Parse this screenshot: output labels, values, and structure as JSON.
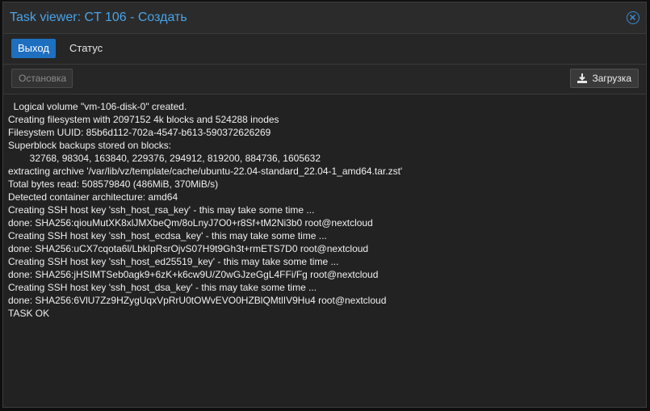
{
  "window": {
    "title": "Task viewer: CT 106 - Создать"
  },
  "tabs": [
    {
      "label": "Выход",
      "active": true
    },
    {
      "label": "Статус",
      "active": false
    }
  ],
  "toolbar": {
    "stop_label": "Остановка",
    "download_label": "Загрузка",
    "download_icon": "download-icon"
  },
  "log": {
    "lines": [
      "  Logical volume \"vm-106-disk-0\" created.",
      "Creating filesystem with 2097152 4k blocks and 524288 inodes",
      "Filesystem UUID: 85b6d112-702a-4547-b613-590372626269",
      "Superblock backups stored on blocks:",
      "        32768, 98304, 163840, 229376, 294912, 819200, 884736, 1605632",
      "extracting archive '/var/lib/vz/template/cache/ubuntu-22.04-standard_22.04-1_amd64.tar.zst'",
      "Total bytes read: 508579840 (486MiB, 370MiB/s)",
      "Detected container architecture: amd64",
      "Creating SSH host key 'ssh_host_rsa_key' - this may take some time ...",
      "done: SHA256:qiouMutXK8xlJMXbeQm/8oLnyJ7O0+r8Sf+tM2Ni3b0 root@nextcloud",
      "Creating SSH host key 'ssh_host_ecdsa_key' - this may take some time ...",
      "done: SHA256:uCX7cqota6l/LbkIpRsrOjvS07H9t9Gh3t+rmETS7D0 root@nextcloud",
      "Creating SSH host key 'ssh_host_ed25519_key' - this may take some time ...",
      "done: SHA256:jHSIMTSeb0agk9+6zK+k6cw9U/Z0wGJzeGgL4FFi/Fg root@nextcloud",
      "Creating SSH host key 'ssh_host_dsa_key' - this may take some time ...",
      "done: SHA256:6VlU7Zz9HZygUqxVpRrU0tOWvEVO0HZBlQMtlIV9Hu4 root@nextcloud",
      "TASK OK"
    ]
  },
  "colors": {
    "accent": "#1e6fbf",
    "title": "#4aa3e8",
    "background": "#262626",
    "log_background": "#222222"
  }
}
